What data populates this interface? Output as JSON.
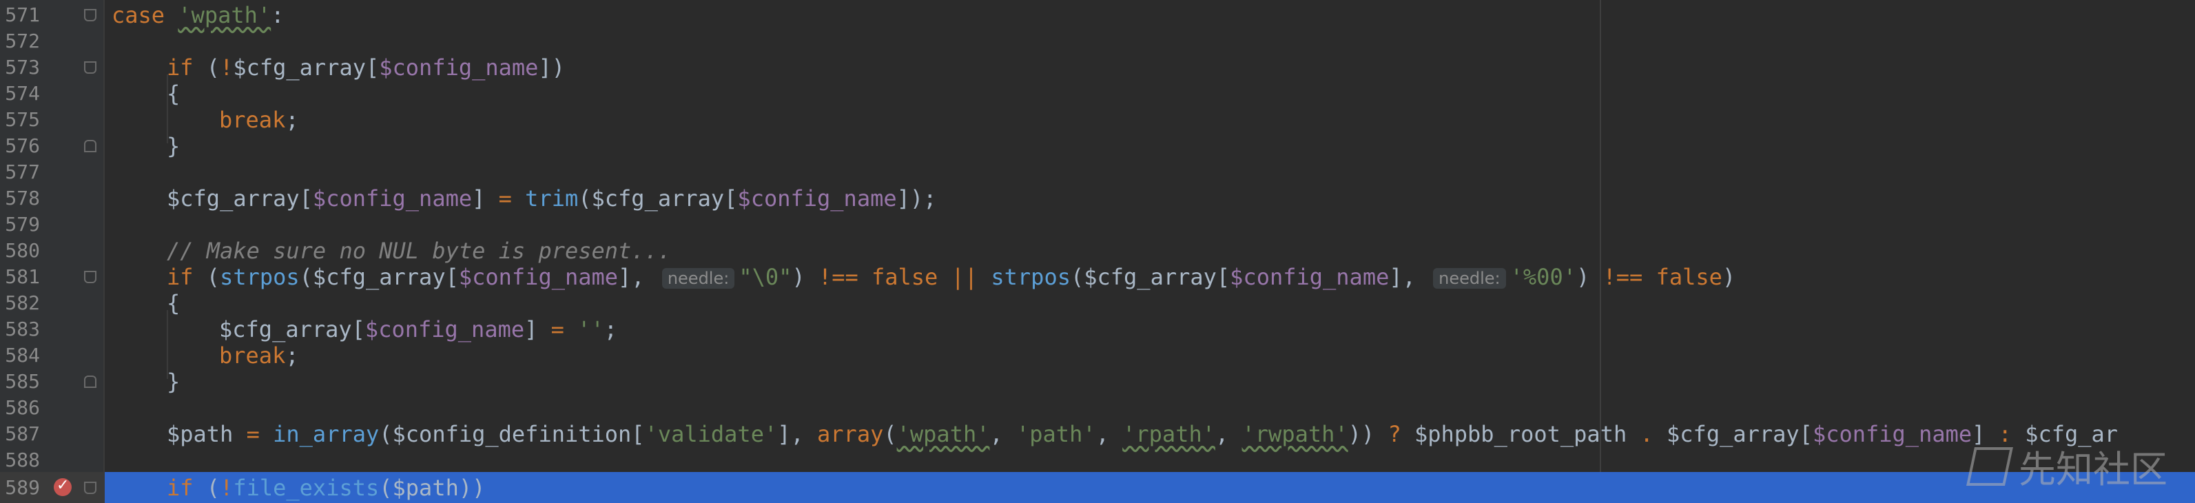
{
  "gutter": {
    "line_numbers": [
      "571",
      "572",
      "573",
      "574",
      "575",
      "576",
      "577",
      "578",
      "579",
      "580",
      "581",
      "582",
      "583",
      "584",
      "585",
      "586",
      "587",
      "588",
      "589"
    ]
  },
  "code": {
    "l571": {
      "kw": "case",
      "str": "'wpath'",
      "rest": ":"
    },
    "l573": {
      "kw": "if",
      "a": " (",
      "op": "!",
      "var": "$cfg_array",
      "b": "[",
      "var2": "$config_name",
      "c": "])"
    },
    "l574": {
      "text": "{"
    },
    "l575": {
      "kw": "break",
      "rest": ";"
    },
    "l576": {
      "text": "}"
    },
    "l578": {
      "var": "$cfg_array",
      "a": "[",
      "var2": "$config_name",
      "b": "] ",
      "op": "=",
      "c": " ",
      "fn": "trim",
      "d": "(",
      "var3": "$cfg_array",
      "e": "[",
      "var4": "$config_name",
      "f": "]);"
    },
    "l580": {
      "comment": "// Make sure no NUL byte is present..."
    },
    "l581": {
      "kw": "if",
      "a": " (",
      "fn1": "strpos",
      "b": "(",
      "var1": "$cfg_array",
      "c": "[",
      "var2": "$config_name",
      "d": "], ",
      "hint1": "needle:",
      "str1": "\"\\0\"",
      "e": ") ",
      "op1": "!== false ||",
      "f": " ",
      "fn2": "strpos",
      "g": "(",
      "var3": "$cfg_array",
      "h": "[",
      "var4": "$config_name",
      "i": "], ",
      "hint2": "needle:",
      "str2": "'%00'",
      "j": ") ",
      "op2": "!== false",
      "k": ")"
    },
    "l582": {
      "text": "{"
    },
    "l583": {
      "var": "$cfg_array",
      "a": "[",
      "var2": "$config_name",
      "b": "] ",
      "op": "=",
      "c": " ",
      "str": "''",
      "d": ";"
    },
    "l584": {
      "kw": "break",
      "rest": ";"
    },
    "l585": {
      "text": "}"
    },
    "l587": {
      "var1": "$path",
      "a": " ",
      "op1": "=",
      "b": " ",
      "fn": "in_array",
      "c": "(",
      "var2": "$config_definition",
      "d": "[",
      "str1": "'validate'",
      "e": "], ",
      "kw": "array",
      "f": "(",
      "str2": "'wpath'",
      "g": ", ",
      "str3": "'path'",
      "h": ", ",
      "str4": "'rpath'",
      "i": ", ",
      "str5": "'rwpath'",
      "j": ")) ",
      "op2": "?",
      "k": " ",
      "var3": "$phpbb_root_path",
      "l": " ",
      "op3": ".",
      "m": " ",
      "var4": "$cfg_array",
      "n": "[",
      "var5": "$config_name",
      "o": "] ",
      "op4": ":",
      "p": " ",
      "var6": "$cfg_ar"
    },
    "l589": {
      "kw": "if",
      "a": " (",
      "op": "!",
      "fn": "file_exists",
      "b": "(",
      "var": "$path",
      "c": "))"
    }
  },
  "watermark": {
    "text": "先知社区"
  },
  "colors": {
    "background": "#2b2b2b",
    "keyword": "#cc7832",
    "string": "#6a8759",
    "variable": "#9876aa",
    "function": "#5c9fd6",
    "comment": "#808080",
    "highlight": "#2f65ca",
    "breakpoint": "#c75450"
  }
}
